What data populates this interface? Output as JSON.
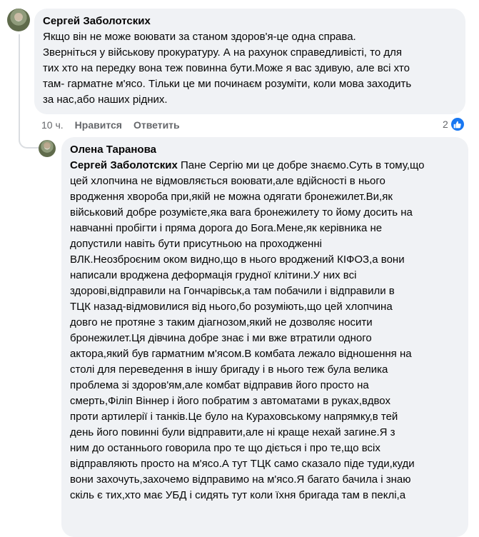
{
  "comment": {
    "author": "Сергей Заболотских",
    "text": "Якщо він не може воювати за станом здоров'я-це одна справа.\nЗверніться у військову прокуратуру. А на рахунок справедливісті, то для\nтих хто на передку вона теж повинна бути.Може я вас здивую, але всі хто\nтам- гарматне м'ясо. Тільки це ми починаєм розуміти, коли мова заходить\nза нас,або наших рідних.",
    "time": "10 ч.",
    "like_label": "Нравится",
    "reply_label": "Ответить",
    "reaction_count": "2",
    "reaction_icon": "like-icon"
  },
  "reply": {
    "author": "Олена Таранова",
    "mention": "Сергей Заболотских",
    "text": " Пане Сергію ми це добре знаємо.Суть в тому,що\nцей хлопчина не відмовляється воювати,але вдійсності в нього\nвродження хвороба при,якій не можна одягати бронежилет.Ви,як\nвійськовий добре розумієте,яка вага бронежилету то йому досить на\nнавчанні пробігти і пряма дорога до Бога.Мене,як керівника не\nдопустили навіть бути присутньою на проходженні\nВЛК.Неозброєним оком видно,що в нього вроджений КІФОЗ,а вони\nнаписали вроджена деформація грудної клітини.У них всі\nздорові,відправили на Гончарівськ,а там побачили і відправили в\nТЦК назад-відмовилися від нього,бо розуміють,що цей хлопчина\nдовго не протяне з таким діагнозом,який не дозволяє носити\nбронежилет.Ця дівчина добре знає і ми вже втратили одного\nактора,який був гарматним м'ясом.В комбата лежало відношення на\nстолі для переведення в іншу бригаду і в нього теж була велика\nпроблема зі здоров'ям,але комбат відправив його просто на\nсмерть,Філіп Віннер і його побратим з автоматами в руках,вдвох\nпроти артилерії і танків.Це було на Кураховському напрямку,в тей\nдень його повинні були відправити,але ні краще нехай загине.Я з\nним до останнього говорила про те що діється і про те,що всіх\nвідправляють просто на м'ясо.А тут ТЦК само сказало піде туди,куди\nвони захочуть,захочемо відправимо на м'ясо.Я багато бачила і знаю\nскіль є тих,хто має УБД і сидять тут коли їхня бригада там в пеклі,а"
  },
  "colors": {
    "bubble": "#f0f2f5",
    "secondary_text": "#65676b",
    "like_blue": "#1877f2"
  }
}
